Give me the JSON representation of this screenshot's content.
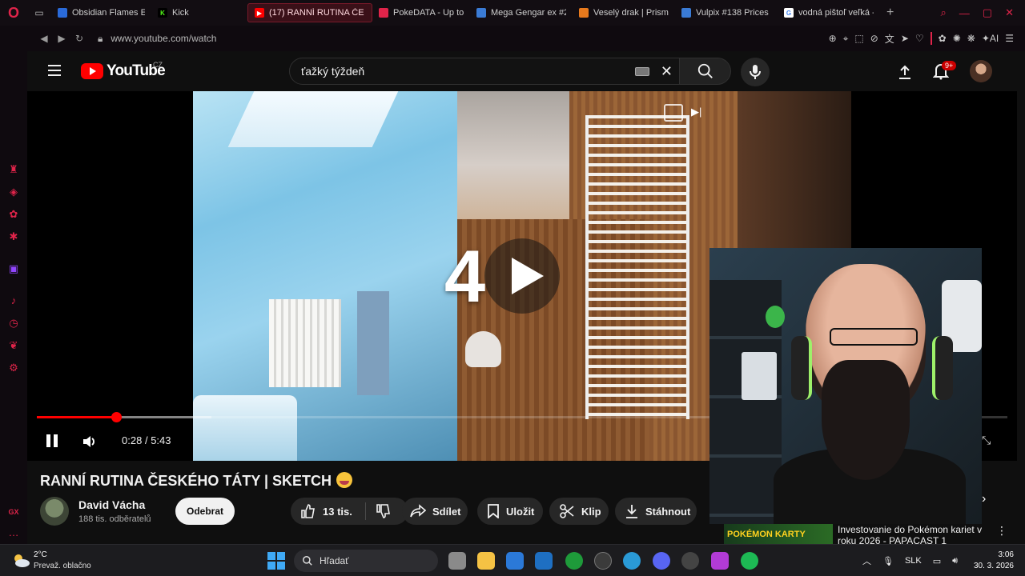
{
  "browser": {
    "tabs": [
      {
        "label": "Obsidian Flames Eli",
        "color": "#2a6ad9",
        "active": false
      },
      {
        "label": "Kick",
        "color": "#53fc18",
        "active": false
      },
      {
        "label": "(17) RANNÍ RUTINA ČE",
        "color": "#ff0000",
        "active": true
      },
      {
        "label": "PokeDATA - Up to d",
        "color": "#e0244a",
        "active": false
      },
      {
        "label": "Mega Gengar ex #2",
        "color": "#3a7bd5",
        "active": false
      },
      {
        "label": "Veselý drak | Prism",
        "color": "#e87a1d",
        "active": false
      },
      {
        "label": "Vulpix #138 Prices",
        "color": "#3a7bd5",
        "active": false
      },
      {
        "label": "vodná pištoľ veľká -",
        "color": "#4285f4",
        "active": false
      }
    ],
    "url": "www.youtube.com/watch",
    "ai_label": "AI"
  },
  "youtube": {
    "logo_text": "YouTube",
    "country": "CZ",
    "search_value": "ťažký týždeň",
    "notification_count": "9+"
  },
  "player": {
    "countdown": "4",
    "current_time": "0:28",
    "duration": "5:43",
    "time_separator": "/",
    "progress": 0.082,
    "buffered": 0.18
  },
  "video": {
    "title": "RANNÍ RUTINA ČESKÉHO TÁTY | SKETCH",
    "channel": "David Vácha",
    "subscribers": "188 tis. odběratelů",
    "unsubscribe_label": "Odebrat",
    "likes": "13 tis.",
    "share_label": "Sdílet",
    "save_label": "Uložit",
    "clip_label": "Klip",
    "download_label": "Stáhnout"
  },
  "related": {
    "thumb_text": "POKÉMON KARTY",
    "title": "Investovanie do Pokémon kariet v roku 2026 - PAPACAST 1"
  },
  "taskbar": {
    "temperature": "2°C",
    "weather": "Prevaž. oblačno",
    "search_placeholder": "Hľadať",
    "language": "SLK",
    "time": "3:06",
    "date": "30. 3. 2026"
  },
  "sidebar": {
    "bottom_label": "GX"
  }
}
